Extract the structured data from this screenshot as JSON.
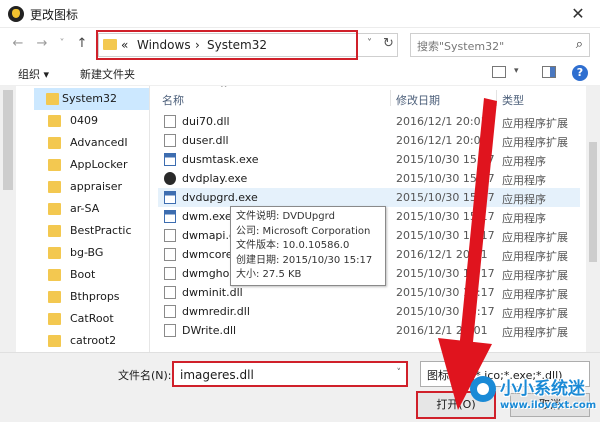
{
  "window": {
    "title": "更改图标",
    "close_glyph": "✕"
  },
  "nav": {
    "back_glyph": "←",
    "forward_glyph": "→",
    "dropdown_glyph": "˅",
    "up_glyph": "↑",
    "address": {
      "crumbs": [
        "«",
        "Windows",
        "›",
        "System32"
      ],
      "dropdown_glyph": "˅",
      "refresh_glyph": "↻"
    },
    "search": {
      "placeholder": "搜索\"System32\"",
      "icon_glyph": "⌕"
    }
  },
  "toolbar": {
    "organize": "组织 ▾",
    "new_folder": "新建文件夹",
    "view_dd_glyph": "▾",
    "help_glyph": "?"
  },
  "sidebar": {
    "root": "System32",
    "items": [
      "0409",
      "AdvancedI",
      "AppLocker",
      "appraiser",
      "ar-SA",
      "BestPractic",
      "bg-BG",
      "Boot",
      "Bthprops",
      "CatRoot",
      "catroot2"
    ]
  },
  "columns": {
    "name": "名称",
    "date": "修改日期",
    "type": "类型",
    "sort_glyph": "^"
  },
  "files": [
    {
      "name": "dui70.dll",
      "date": "2016/12/1 20:01",
      "type": "应用程序扩展",
      "icon": "dll"
    },
    {
      "name": "duser.dll",
      "date": "2016/12/1 20:01",
      "type": "应用程序扩展",
      "icon": "dll"
    },
    {
      "name": "dusmtask.exe",
      "date": "2015/10/30 15:17",
      "type": "应用程序",
      "icon": "exe"
    },
    {
      "name": "dvdplay.exe",
      "date": "2015/10/30 15:17",
      "type": "应用程序",
      "icon": "dvd"
    },
    {
      "name": "dvdupgrd.exe",
      "date": "2015/10/30 15:17",
      "type": "应用程序",
      "icon": "exe"
    },
    {
      "name": "dwm.exe",
      "date": "2015/10/30 15:17",
      "type": "应用程序",
      "icon": "exe"
    },
    {
      "name": "dwmapi.dll",
      "date": "2015/10/30 15:17",
      "type": "应用程序扩展",
      "icon": "dll"
    },
    {
      "name": "dwmcore.dll",
      "date": "2016/12/1 20:01",
      "type": "应用程序扩展",
      "icon": "dll"
    },
    {
      "name": "dwmghost.dll",
      "date": "2015/10/30 15:17",
      "type": "应用程序扩展",
      "icon": "dll"
    },
    {
      "name": "dwminit.dll",
      "date": "2015/10/30 15:17",
      "type": "应用程序扩展",
      "icon": "dll"
    },
    {
      "name": "dwmredir.dll",
      "date": "2015/10/30 15:17",
      "type": "应用程序扩展",
      "icon": "dll"
    },
    {
      "name": "DWrite.dll",
      "date": "2016/12/1 20:01",
      "type": "应用程序扩展",
      "icon": "dll"
    }
  ],
  "tooltip": {
    "lines": [
      "文件说明: DVDUpgrd",
      "公司: Microsoft Corporation",
      "文件版本: 10.0.10586.0",
      "创建日期: 2015/10/30 15:17",
      "大小: 27.5 KB"
    ]
  },
  "bottom": {
    "filename_label": "文件名(N):",
    "filename_value": "imageres.dll",
    "filename_dd_glyph": "˅",
    "filter_value": "图标文件(*.ico;*.exe;*.dll)",
    "open_label": "打开(O)",
    "cancel_label": "取消"
  },
  "watermark": {
    "title": "小小系统迷",
    "url": "www.ilovext.com"
  },
  "colors": {
    "highlight_red": "#d0202a",
    "arrow_red": "#e0141e",
    "selection": "#cce8ff",
    "hover": "#e5f1fb",
    "brand_blue": "#1a8ad6"
  }
}
